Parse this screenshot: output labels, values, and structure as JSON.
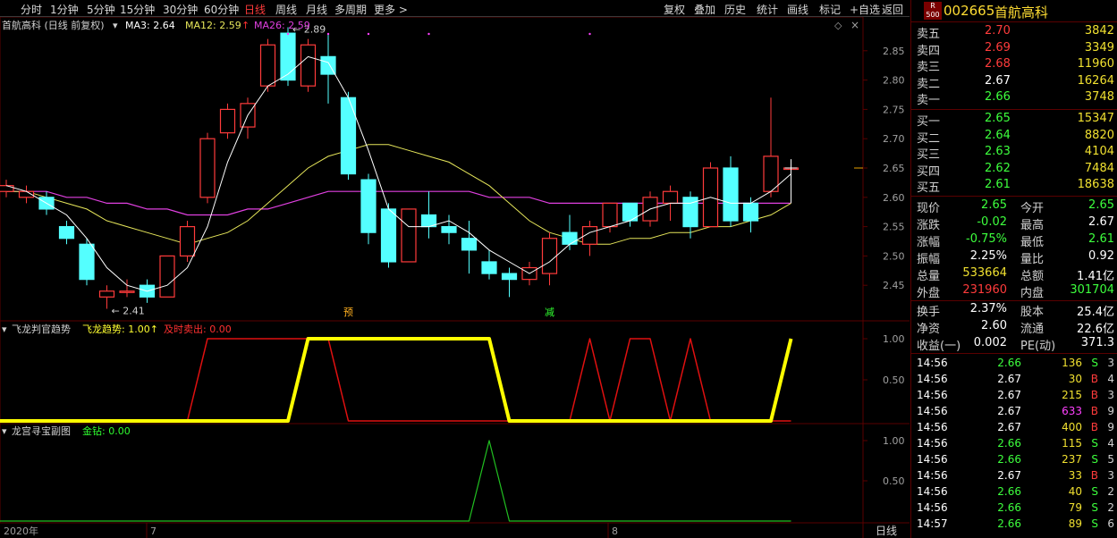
{
  "toolbar": {
    "periods": [
      "分时",
      "1分钟",
      "5分钟",
      "15分钟",
      "30分钟",
      "60分钟",
      "日线",
      "周线",
      "月线",
      "多周期",
      "更多 >"
    ],
    "active": "日线",
    "actions": [
      "复权",
      "叠加",
      "历史",
      "统计",
      "画线",
      "标记",
      "+自选",
      "返回"
    ]
  },
  "stock": {
    "code": "002665",
    "name": "首航高科",
    "badge_top": "R",
    "badge_bottom": "500"
  },
  "main_legend": {
    "name": "首航高科 (日线 前复权)",
    "ma3": "MA3: 2.64",
    "ma12": "MA12: 2.59",
    "ma26": "MA26: 2.59"
  },
  "main_annotations": {
    "high_label": "2.89",
    "low_label": "2.41",
    "mark_yu": "预",
    "mark_jian": "减"
  },
  "sub1_legend": {
    "name": "飞龙判官趋势",
    "fl": "飞龙趋势: 1.00↑",
    "sell": "及时卖出: 0.00"
  },
  "sub2_legend": {
    "name": "龙宫寻宝副图",
    "jz": "金钻: 0.00"
  },
  "axis": {
    "price_ticks": [
      "2.85",
      "2.80",
      "2.75",
      "2.70",
      "2.65",
      "2.60",
      "2.55",
      "2.50",
      "2.45"
    ],
    "sub_ticks": [
      "1.00",
      "0.50"
    ],
    "x_labels": [
      "2020年",
      "7",
      "8"
    ],
    "day_button": "日线"
  },
  "colors": {
    "up": "#ff3b3b",
    "down": "#54ffff",
    "ma3": "#ffffff",
    "ma12": "#e6e65a",
    "ma26": "#e040e0",
    "fl": "#ffff00",
    "sell": "#e01010",
    "jz": "#20c020"
  },
  "chart_data": {
    "type": "candlestick",
    "ylim": [
      2.41,
      2.89
    ],
    "candles": [
      {
        "o": 2.61,
        "c": 2.62,
        "h": 2.63,
        "l": 2.6
      },
      {
        "o": 2.6,
        "c": 2.61,
        "h": 2.62,
        "l": 2.59
      },
      {
        "o": 2.6,
        "c": 2.58,
        "h": 2.61,
        "l": 2.57
      },
      {
        "o": 2.55,
        "c": 2.53,
        "h": 2.56,
        "l": 2.52
      },
      {
        "o": 2.52,
        "c": 2.46,
        "h": 2.53,
        "l": 2.45
      },
      {
        "o": 2.43,
        "c": 2.44,
        "h": 2.45,
        "l": 2.41
      },
      {
        "o": 2.44,
        "c": 2.44,
        "h": 2.46,
        "l": 2.43
      },
      {
        "o": 2.45,
        "c": 2.43,
        "h": 2.46,
        "l": 2.42
      },
      {
        "o": 2.43,
        "c": 2.5,
        "h": 2.5,
        "l": 2.43
      },
      {
        "o": 2.5,
        "c": 2.55,
        "h": 2.56,
        "l": 2.49
      },
      {
        "o": 2.6,
        "c": 2.7,
        "h": 2.71,
        "l": 2.59
      },
      {
        "o": 2.71,
        "c": 2.75,
        "h": 2.76,
        "l": 2.7
      },
      {
        "o": 2.72,
        "c": 2.76,
        "h": 2.77,
        "l": 2.7
      },
      {
        "o": 2.79,
        "c": 2.86,
        "h": 2.87,
        "l": 2.78
      },
      {
        "o": 2.88,
        "c": 2.8,
        "h": 2.89,
        "l": 2.79
      },
      {
        "o": 2.79,
        "c": 2.86,
        "h": 2.87,
        "l": 2.78
      },
      {
        "o": 2.84,
        "c": 2.81,
        "h": 2.88,
        "l": 2.76
      },
      {
        "o": 2.77,
        "c": 2.64,
        "h": 2.78,
        "l": 2.63
      },
      {
        "o": 2.63,
        "c": 2.54,
        "h": 2.64,
        "l": 2.52
      },
      {
        "o": 2.58,
        "c": 2.49,
        "h": 2.59,
        "l": 2.48
      },
      {
        "o": 2.49,
        "c": 2.58,
        "h": 2.58,
        "l": 2.49
      },
      {
        "o": 2.57,
        "c": 2.55,
        "h": 2.61,
        "l": 2.53
      },
      {
        "o": 2.55,
        "c": 2.54,
        "h": 2.57,
        "l": 2.52
      },
      {
        "o": 2.53,
        "c": 2.51,
        "h": 2.56,
        "l": 2.47
      },
      {
        "o": 2.49,
        "c": 2.47,
        "h": 2.51,
        "l": 2.46
      },
      {
        "o": 2.47,
        "c": 2.46,
        "h": 2.48,
        "l": 2.43
      },
      {
        "o": 2.46,
        "c": 2.48,
        "h": 2.49,
        "l": 2.45
      },
      {
        "o": 2.47,
        "c": 2.53,
        "h": 2.54,
        "l": 2.45
      },
      {
        "o": 2.54,
        "c": 2.52,
        "h": 2.57,
        "l": 2.51
      },
      {
        "o": 2.52,
        "c": 2.55,
        "h": 2.56,
        "l": 2.5
      },
      {
        "o": 2.55,
        "c": 2.59,
        "h": 2.59,
        "l": 2.54
      },
      {
        "o": 2.59,
        "c": 2.56,
        "h": 2.59,
        "l": 2.55
      },
      {
        "o": 2.56,
        "c": 2.6,
        "h": 2.61,
        "l": 2.55
      },
      {
        "o": 2.59,
        "c": 2.61,
        "h": 2.62,
        "l": 2.56
      },
      {
        "o": 2.6,
        "c": 2.55,
        "h": 2.61,
        "l": 2.53
      },
      {
        "o": 2.55,
        "c": 2.65,
        "h": 2.66,
        "l": 2.55
      },
      {
        "o": 2.65,
        "c": 2.56,
        "h": 2.67,
        "l": 2.55
      },
      {
        "o": 2.59,
        "c": 2.56,
        "h": 2.6,
        "l": 2.54
      },
      {
        "o": 2.61,
        "c": 2.67,
        "h": 2.77,
        "l": 2.6
      },
      {
        "o": 2.65,
        "c": 2.65,
        "h": 2.66,
        "l": 2.61
      }
    ],
    "ma3": [
      2.62,
      2.61,
      2.59,
      2.57,
      2.53,
      2.48,
      2.45,
      2.44,
      2.45,
      2.48,
      2.55,
      2.66,
      2.74,
      2.79,
      2.81,
      2.84,
      2.83,
      2.77,
      2.68,
      2.58,
      2.55,
      2.55,
      2.56,
      2.54,
      2.51,
      2.49,
      2.47,
      2.49,
      2.52,
      2.54,
      2.55,
      2.56,
      2.58,
      2.59,
      2.59,
      2.6,
      2.59,
      2.59,
      2.61,
      2.64
    ],
    "ma12": [
      2.61,
      2.61,
      2.6,
      2.59,
      2.58,
      2.56,
      2.55,
      2.54,
      2.53,
      2.52,
      2.53,
      2.54,
      2.56,
      2.59,
      2.62,
      2.65,
      2.67,
      2.68,
      2.69,
      2.69,
      2.68,
      2.67,
      2.66,
      2.64,
      2.62,
      2.59,
      2.56,
      2.54,
      2.53,
      2.52,
      2.52,
      2.53,
      2.53,
      2.54,
      2.54,
      2.55,
      2.55,
      2.56,
      2.57,
      2.59
    ],
    "ma26": [
      2.61,
      2.61,
      2.61,
      2.6,
      2.6,
      2.59,
      2.59,
      2.58,
      2.58,
      2.57,
      2.57,
      2.57,
      2.58,
      2.58,
      2.59,
      2.6,
      2.61,
      2.61,
      2.61,
      2.61,
      2.61,
      2.61,
      2.61,
      2.61,
      2.6,
      2.6,
      2.6,
      2.59,
      2.59,
      2.59,
      2.59,
      2.59,
      2.59,
      2.59,
      2.59,
      2.59,
      2.59,
      2.59,
      2.59,
      2.59
    ],
    "fl": [
      0,
      0,
      0,
      0,
      0,
      0,
      0,
      0,
      0,
      0,
      0,
      0,
      0,
      0,
      0,
      1,
      1,
      1,
      1,
      1,
      1,
      1,
      1,
      1,
      1,
      0,
      0,
      0,
      0,
      0,
      0,
      0,
      0,
      0,
      0,
      0,
      0,
      0,
      0,
      1
    ],
    "sell": [
      0,
      0,
      0,
      0,
      0,
      0,
      0,
      0,
      0,
      0,
      1,
      1,
      1,
      1,
      1,
      1,
      1,
      0,
      0,
      0,
      0,
      0,
      0,
      0,
      0,
      0,
      0,
      0,
      0,
      1,
      0,
      1,
      1,
      0,
      1,
      0,
      0,
      0,
      0,
      0
    ],
    "jz": [
      0,
      0,
      0,
      0,
      0,
      0,
      0,
      0,
      0,
      0,
      0,
      0,
      0,
      0,
      0,
      0,
      0,
      0,
      0,
      0,
      0,
      0,
      0,
      0,
      1,
      0,
      0,
      0,
      0,
      0,
      0,
      0,
      0,
      0,
      0,
      0,
      0,
      0,
      0,
      0
    ]
  },
  "quote_book": {
    "asks": [
      {
        "label": "卖五",
        "price": "2.70",
        "vol": "3842"
      },
      {
        "label": "卖四",
        "price": "2.69",
        "vol": "3349"
      },
      {
        "label": "卖三",
        "price": "2.68",
        "vol": "11960"
      },
      {
        "label": "卖二",
        "price": "2.67",
        "vol": "16264"
      },
      {
        "label": "卖一",
        "price": "2.66",
        "vol": "3748"
      }
    ],
    "bids": [
      {
        "label": "买一",
        "price": "2.65",
        "vol": "15347"
      },
      {
        "label": "买二",
        "price": "2.64",
        "vol": "8820"
      },
      {
        "label": "买三",
        "price": "2.63",
        "vol": "4104"
      },
      {
        "label": "买四",
        "price": "2.62",
        "vol": "7484"
      },
      {
        "label": "买五",
        "price": "2.61",
        "vol": "18638"
      }
    ]
  },
  "stats1": [
    {
      "l1": "现价",
      "v1": "2.65",
      "l2": "今开",
      "v2": "2.65"
    },
    {
      "l1": "涨跌",
      "v1": "-0.02",
      "l2": "最高",
      "v2": "2.67"
    },
    {
      "l1": "涨幅",
      "v1": "-0.75%",
      "l2": "最低",
      "v2": "2.61"
    },
    {
      "l1": "振幅",
      "v1": "2.25%",
      "l2": "量比",
      "v2": "0.92"
    },
    {
      "l1": "总量",
      "v1": "533664",
      "l2": "总额",
      "v2": "1.41亿"
    },
    {
      "l1": "外盘",
      "v1": "231960",
      "l2": "内盘",
      "v2": "301704"
    }
  ],
  "stats2": [
    {
      "l1": "换手",
      "v1": "2.37%",
      "l2": "股本",
      "v2": "25.4亿"
    },
    {
      "l1": "净资",
      "v1": "2.60",
      "l2": "流通",
      "v2": "22.6亿"
    },
    {
      "l1": "收益(一)",
      "v1": "0.002",
      "l2": "PE(动)",
      "v2": "371.3"
    }
  ],
  "ticks": [
    {
      "t": "14:56",
      "p": "2.66",
      "v": "136",
      "s": "S",
      "n": "3"
    },
    {
      "t": "14:56",
      "p": "2.67",
      "v": "30",
      "s": "B",
      "n": "4"
    },
    {
      "t": "14:56",
      "p": "2.67",
      "v": "215",
      "s": "B",
      "n": "3"
    },
    {
      "t": "14:56",
      "p": "2.67",
      "v": "633",
      "s": "B",
      "n": "9"
    },
    {
      "t": "14:56",
      "p": "2.67",
      "v": "400",
      "s": "B",
      "n": "9"
    },
    {
      "t": "14:56",
      "p": "2.66",
      "v": "115",
      "s": "S",
      "n": "4"
    },
    {
      "t": "14:56",
      "p": "2.66",
      "v": "237",
      "s": "S",
      "n": "5"
    },
    {
      "t": "14:56",
      "p": "2.67",
      "v": "33",
      "s": "B",
      "n": "3"
    },
    {
      "t": "14:56",
      "p": "2.66",
      "v": "40",
      "s": "S",
      "n": "2"
    },
    {
      "t": "14:56",
      "p": "2.66",
      "v": "79",
      "s": "S",
      "n": "2"
    },
    {
      "t": "14:57",
      "p": "2.66",
      "v": "89",
      "s": "S",
      "n": "6"
    }
  ]
}
